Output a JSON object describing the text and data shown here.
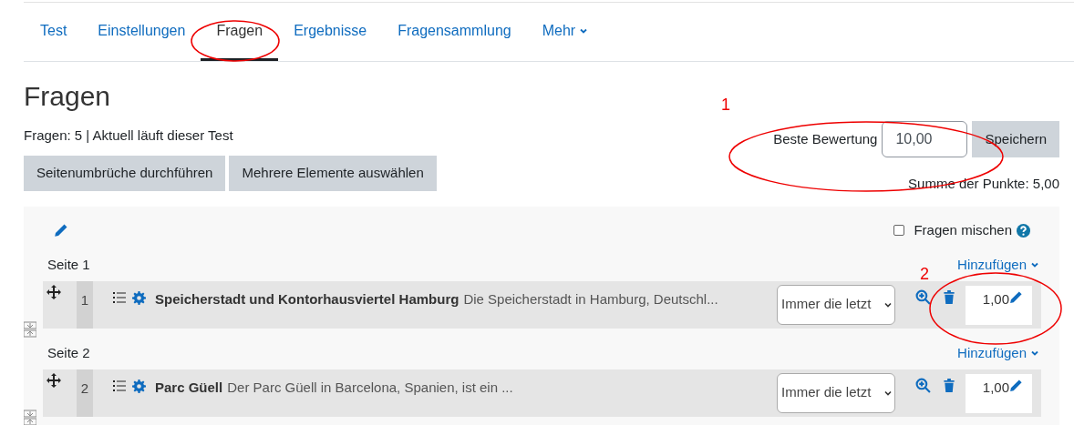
{
  "tabs": [
    {
      "label": "Test",
      "selected": false,
      "kind": "link"
    },
    {
      "label": "Einstellungen",
      "selected": false,
      "kind": "link"
    },
    {
      "label": "Fragen",
      "selected": true,
      "kind": "link"
    },
    {
      "label": "Ergebnisse",
      "selected": false,
      "kind": "link"
    },
    {
      "label": "Fragensammlung",
      "selected": false,
      "kind": "link"
    },
    {
      "label": "Mehr",
      "selected": false,
      "kind": "dropdown"
    }
  ],
  "heading": "Fragen",
  "info": "Fragen: 5 | Aktuell läuft dieser Test",
  "buttons": [
    "Seitenumbrüche durchführen",
    "Mehrere Elemente auswählen"
  ],
  "max_grade": {
    "label": "Beste Bewertung",
    "value": "10,00",
    "button": "Speichern"
  },
  "total": "Summe der Punkte: 5,00",
  "section": {
    "shuffle": {
      "label": "Fragen mischen",
      "checked": false
    },
    "pages": [
      {
        "label": "Seite 1",
        "add_label": "Hinzufügen",
        "questions": [
          {
            "number": "1",
            "name": "Speicherstadt und Kontorhausviertel Hamburg",
            "description": "Die Speicherstadt in Hamburg, Deutschl...",
            "behaviour": "Immer die letzt",
            "grade": "1,00"
          }
        ]
      },
      {
        "label": "Seite 2",
        "add_label": "Hinzufügen",
        "questions": [
          {
            "number": "2",
            "name": "Parc Güell",
            "description": "Der Parc Güell in Barcelona, Spanien, ist ein ...",
            "behaviour": "Immer die letzt",
            "grade": "1,00"
          }
        ]
      }
    ]
  },
  "annotations": [
    {
      "label": "1"
    },
    {
      "label": "2"
    }
  ]
}
